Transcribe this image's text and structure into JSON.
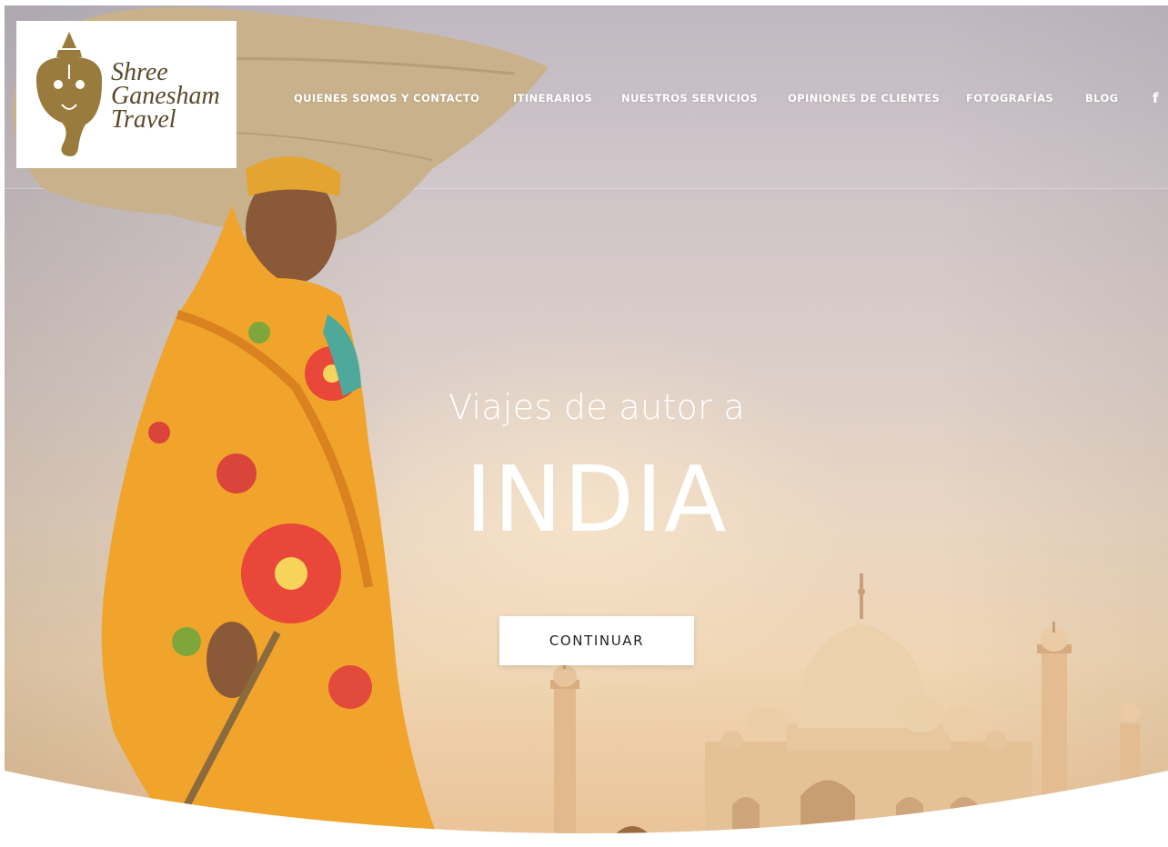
{
  "site": {
    "logo": {
      "line1": "Shree",
      "line2": "Ganesham",
      "line3": "Travel",
      "icon": "ganesha-logo-icon"
    },
    "nav": {
      "items": [
        {
          "label": "QUIENES SOMOS Y CONTACTO"
        },
        {
          "label": "ITINERARIOS"
        },
        {
          "label": "NUESTROS SERVICIOS"
        },
        {
          "label": "OPINIONES DE CLIENTES"
        },
        {
          "label": "FOTOGRAFÍAS"
        },
        {
          "label": "BLOG"
        }
      ],
      "social_icon": "facebook-icon",
      "social_glyph": "f"
    }
  },
  "hero": {
    "subtitle": "Viajes de autor a",
    "title": "INDIA",
    "cta_label": "CONTINUAR",
    "colors": {
      "sky_top": "#bcb4be",
      "sky_bottom": "#e9c297",
      "sari_orange": "#f2a12a",
      "sari_red": "#e0413a",
      "sack": "#cbb48e",
      "marble": "#e8c9a0"
    }
  }
}
